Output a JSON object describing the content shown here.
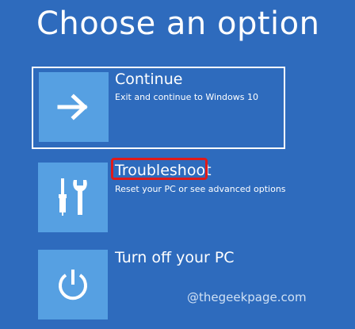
{
  "page": {
    "title": "Choose an option"
  },
  "options": [
    {
      "title": "Continue",
      "description": "Exit and continue to Windows 10",
      "icon": "arrow-right-icon",
      "selected": true
    },
    {
      "title": "Troubleshoot",
      "description": "Reset your PC or see advanced options",
      "icon": "tools-icon",
      "highlighted": true
    },
    {
      "title": "Turn off your PC",
      "description": "",
      "icon": "power-icon"
    }
  ],
  "watermark": "@thegeekpage.com",
  "colors": {
    "background": "#2e6bbd",
    "tile": "#56a0e2",
    "highlight": "#e01a1a"
  }
}
